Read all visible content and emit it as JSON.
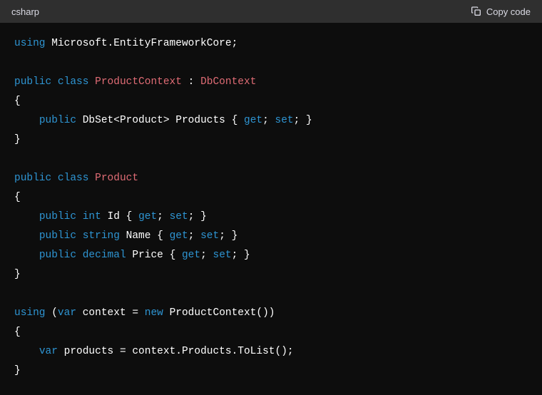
{
  "header": {
    "language": "csharp",
    "copy_label": "Copy code"
  },
  "code": {
    "tokens": {
      "using": "using",
      "public": "public",
      "class": "class",
      "var": "var",
      "new": "new",
      "get": "get",
      "set": "set",
      "int": "int",
      "string": "string",
      "decimal": "decimal"
    },
    "identifiers": {
      "ms_ef": "Microsoft.EntityFrameworkCore",
      "product_context": "ProductContext",
      "db_context": "DbContext",
      "dbset_product": "DbSet<Product>",
      "products": "Products",
      "product": "Product",
      "id": "Id",
      "name": "Name",
      "price": "Price",
      "context": "context",
      "products_var": "products",
      "to_list": "context.Products.ToList()"
    }
  }
}
